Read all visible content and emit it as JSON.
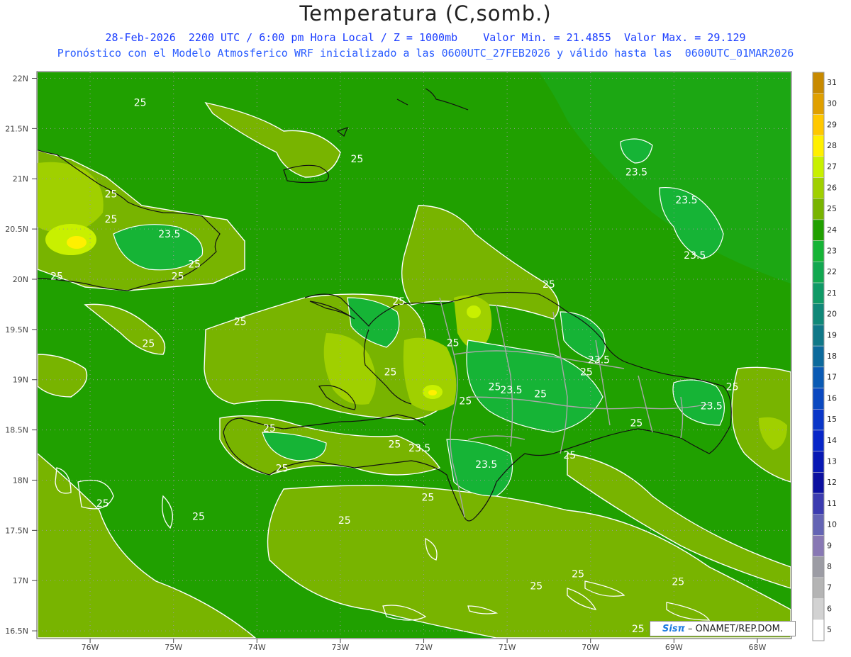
{
  "header": {
    "title": "Temperatura (C,somb.)",
    "line1": "28-Feb-2026  2200 UTC / 6:00 pm Hora Local / Z = 1000mb    Valor Min. = 21.4855  Valor Max. = 29.129",
    "line2": "Pronóstico con el Modelo Atmosferico WRF inicializado a las 0600UTC_27FEB2026 y válido hasta las  0600UTC_01MAR2026"
  },
  "axes": {
    "lat_labels": [
      "22N",
      "21.5N",
      "21N",
      "20.5N",
      "20N",
      "19.5N",
      "19N",
      "18.5N",
      "18N",
      "17.5N",
      "17N",
      "16.5N"
    ],
    "lon_labels": [
      "76W",
      "75W",
      "74W",
      "73W",
      "72W",
      "71W",
      "70W",
      "69W",
      "68W"
    ]
  },
  "colorbar": {
    "labels": [
      "31",
      "30",
      "29",
      "28",
      "27",
      "26",
      "25",
      "24",
      "23",
      "22",
      "21",
      "20",
      "19",
      "18",
      "17",
      "16",
      "15",
      "14",
      "13",
      "12",
      "11",
      "10",
      "9",
      "8",
      "7",
      "6",
      "5"
    ],
    "colors": [
      "#c88a00",
      "#e0a000",
      "#ffc800",
      "#fff000",
      "#c8f000",
      "#a0d000",
      "#78b400",
      "#20a000",
      "#16b436",
      "#12a850",
      "#109a66",
      "#108878",
      "#107888",
      "#0c6a9c",
      "#0a5ab4",
      "#0a48c0",
      "#0a36c8",
      "#0826c8",
      "#0818b4",
      "#0c10a0",
      "#3c3cb0",
      "#6464b4",
      "#8878b4",
      "#9c9ca4",
      "#b4b4b4",
      "#d2d2d2",
      "#ffffff"
    ]
  },
  "contour_labels": [
    {
      "text": "25",
      "lon": -75.4,
      "lat": 21.76
    },
    {
      "text": "25",
      "lon": -72.8,
      "lat": 21.2
    },
    {
      "text": "25",
      "lon": -75.75,
      "lat": 20.85
    },
    {
      "text": "25",
      "lon": -75.75,
      "lat": 20.6
    },
    {
      "text": "23.5",
      "lon": -75.05,
      "lat": 20.45
    },
    {
      "text": "25",
      "lon": -74.75,
      "lat": 20.15
    },
    {
      "text": "25",
      "lon": -76.4,
      "lat": 20.03
    },
    {
      "text": "25",
      "lon": -74.95,
      "lat": 20.03
    },
    {
      "text": "25",
      "lon": -75.3,
      "lat": 19.36
    },
    {
      "text": "25",
      "lon": -74.2,
      "lat": 19.58
    },
    {
      "text": "25",
      "lon": -72.3,
      "lat": 19.78
    },
    {
      "text": "25",
      "lon": -72.4,
      "lat": 19.08
    },
    {
      "text": "25",
      "lon": -71.65,
      "lat": 19.37
    },
    {
      "text": "25",
      "lon": -71.15,
      "lat": 18.93
    },
    {
      "text": "23.5",
      "lon": -70.95,
      "lat": 18.9
    },
    {
      "text": "25",
      "lon": -71.5,
      "lat": 18.79
    },
    {
      "text": "25",
      "lon": -70.6,
      "lat": 18.86
    },
    {
      "text": "23.5",
      "lon": -69.9,
      "lat": 19.2
    },
    {
      "text": "25",
      "lon": -70.05,
      "lat": 19.08
    },
    {
      "text": "25",
      "lon": -69.45,
      "lat": 18.57
    },
    {
      "text": "25",
      "lon": -70.25,
      "lat": 18.25
    },
    {
      "text": "23.5",
      "lon": -68.55,
      "lat": 18.74
    },
    {
      "text": "25",
      "lon": -68.3,
      "lat": 18.93
    },
    {
      "text": "25",
      "lon": -73.85,
      "lat": 18.52
    },
    {
      "text": "25",
      "lon": -72.35,
      "lat": 18.36
    },
    {
      "text": "23.5",
      "lon": -72.05,
      "lat": 18.32
    },
    {
      "text": "23.5",
      "lon": -71.25,
      "lat": 18.16
    },
    {
      "text": "25",
      "lon": -73.7,
      "lat": 18.12
    },
    {
      "text": "25",
      "lon": -71.95,
      "lat": 17.83
    },
    {
      "text": "25",
      "lon": -75.85,
      "lat": 17.77
    },
    {
      "text": "25",
      "lon": -74.7,
      "lat": 17.64
    },
    {
      "text": "25",
      "lon": -72.95,
      "lat": 17.6
    },
    {
      "text": "23.5",
      "lon": -69.45,
      "lat": 21.07
    },
    {
      "text": "23.5",
      "lon": -68.85,
      "lat": 20.79
    },
    {
      "text": "23.5",
      "lon": -68.75,
      "lat": 20.24
    },
    {
      "text": "25",
      "lon": -70.5,
      "lat": 19.95
    },
    {
      "text": "25",
      "lon": -70.15,
      "lat": 17.07
    },
    {
      "text": "25",
      "lon": -68.95,
      "lat": 16.99
    },
    {
      "text": "25",
      "lon": -70.65,
      "lat": 16.95
    },
    {
      "text": "25",
      "lon": -69.43,
      "lat": 16.52
    }
  ],
  "credit": {
    "logo": "Sisπ",
    "text": " – ONAMET/REP.DOM."
  }
}
